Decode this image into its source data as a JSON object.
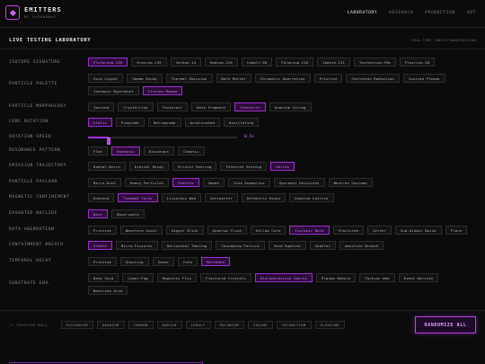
{
  "brand": {
    "name": "EMITTERS",
    "subtitle": "BY PLEXWORKS"
  },
  "nav": [
    "LABORATORY",
    "RESEARCH",
    "PRODUCTION",
    "ART"
  ],
  "page": {
    "title": "LIVE TESTING LABORATORY",
    "subtitle": "REAL-TIME CONFIG MANIPULATION"
  },
  "rows": [
    {
      "label": "ISOTOPE SIGNATURE",
      "options": [
        "Plutonium-239",
        "Uranium-235",
        "Carbon-14",
        "Radium-226",
        "Cobalt-60",
        "Polonium-210",
        "Iodine-131",
        "Technetium-99m",
        "Fluorine-18"
      ],
      "selected": [
        0
      ]
    },
    {
      "label": "PARTICLE PALETTE",
      "options": [
        "Void Signal",
        "Gamma Decay",
        "Thermal Emission",
        "Dark Matter",
        "Chromatic Aberration",
        "Pristine",
        "Cherenkov Radiation",
        "Ionized Plasma",
        "Isotopic Byproduct",
        "Fission Magma"
      ],
      "selected": [
        9
      ]
    },
    {
      "label": "PARTICLE MORPHOLOGY",
      "options": [
        "Ionized",
        "Crystalline",
        "Tesseract",
        "Data Fragment",
        "Starburst",
        "Quantum String"
      ],
      "selected": [
        4
      ]
    },
    {
      "label": "CORE ROTATION",
      "options": [
        "Static",
        "Prograde",
        "Retrograde",
        "Accelerated",
        "Oscillating"
      ],
      "selected": [
        0
      ]
    },
    {
      "label": "RESONANCE PATTERN",
      "options": [
        "Flat",
        "Harmonic",
        "Dissonant",
        "Chaotic"
      ],
      "selected": [
        1
      ]
    },
    {
      "label": "EMISSION TRAJECTORY",
      "options": [
        "Radial Burst",
        "Orbital Decay",
        "Erratic Venting",
        "Tethered Venting",
        "Vortex"
      ],
      "selected": [
        4
      ]
    },
    {
      "label": "PARTICLE PAYLOAD",
      "options": [
        "Micro-Dust",
        "Heavy Particles",
        "Photons",
        "Smoke",
        "Void Anomalies",
        "Sporadic Emissions",
        "Neutron Cascade"
      ],
      "selected": [
        2
      ]
    },
    {
      "label": "MAGNETIC CONFINEMENT",
      "options": [
        "Unbound",
        "Tokamak Torus",
        "Lissajous Web",
        "Antimatter",
        "Helmholtz Rings",
        "Quantum Lattice"
      ],
      "selected": [
        1
      ]
    },
    {
      "label": "DAUGHTER NUCLIDE",
      "options": [
        "None",
        "Observable"
      ],
      "selected": [
        0
      ]
    },
    {
      "label": "DATA ABERRATION",
      "options": [
        "Pristine",
        "Waveform Ghost",
        "Signal Slice",
        "Quantum Fluxe",
        "Hollow Core",
        "Isotopic Bold",
        "Fractured",
        "Jitter",
        "Sub-Atomic Noise",
        "Flare"
      ],
      "selected": [
        5
      ]
    },
    {
      "label": "CONTAINMENT BREACH",
      "options": [
        "Stable",
        "Micro-Fissures",
        "Horizontal Tearing",
        "Cascading Failure",
        "Void Rupture",
        "Shatter",
        "Absolute Breach"
      ],
      "selected": [
        0
      ]
    },
    {
      "label": "TEMPORAL DECAY",
      "options": [
        "Pristine",
        "Ghosting",
        "Smear",
        "Echo",
        "Meltdown"
      ],
      "selected": [
        4
      ]
    },
    {
      "label": "SUBSTRATE ENV.",
      "options": [
        "Deep Void",
        "Cyber-Fog",
        "Magnetic Flux",
        "Fractured Crystals",
        "Bioluminescent Spores",
        "Plasma Nebula",
        "Tachyon Web",
        "Event Horizon",
        "Neutrino Grid"
      ],
      "selected": [
        4
      ]
    }
  ],
  "rotation_speed": {
    "label": "ROTATION SPEED",
    "value_text": "0.5x",
    "fraction": 0.14
  },
  "targets": {
    "label": "17 TARGETED MOLS:",
    "items": [
      "PLUTONIUM",
      "URANIUM",
      "CARBON",
      "RADIUM",
      "COBALT",
      "POLONIUM",
      "IODINE",
      "TECHNETIUM",
      "FLUORINE"
    ]
  },
  "randomize_label": "RANDOMIZE ALL",
  "colors": {
    "accent": "#a233d6",
    "accent_text": "#d27cf5",
    "background": "#0b0b0c"
  }
}
